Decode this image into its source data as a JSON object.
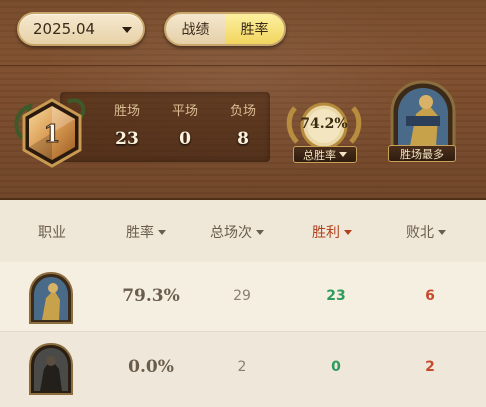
{
  "top_bar": {
    "date_value": "2025.04",
    "tabs": [
      {
        "label": "战绩",
        "active": false
      },
      {
        "label": "胜率",
        "active": true
      }
    ]
  },
  "summary": {
    "rank": "1",
    "wins_label": "胜场",
    "draws_label": "平场",
    "losses_label": "负场",
    "wins": "23",
    "draws": "0",
    "losses": "8",
    "win_rate": "74.2%",
    "win_rate_label": "总胜率",
    "most_wins_label": "胜场最多"
  },
  "table": {
    "headers": {
      "class": "职业",
      "win_rate": "胜率",
      "total": "总场次",
      "wins": "胜利",
      "losses": "败北"
    },
    "rows": [
      {
        "win_rate": "79.3%",
        "total": "29",
        "wins": "23",
        "losses": "6",
        "portrait": "gold-hero-portrait"
      },
      {
        "win_rate": "0.0%",
        "total": "2",
        "wins": "0",
        "losses": "2",
        "portrait": "dark-hero-portrait"
      }
    ]
  },
  "colors": {
    "wood": "#7b4c2c",
    "accent_active": "#f1d55e",
    "win_green": "#2e9a5c",
    "loss_red": "#c84a2c",
    "sort_active": "#b0421f"
  }
}
